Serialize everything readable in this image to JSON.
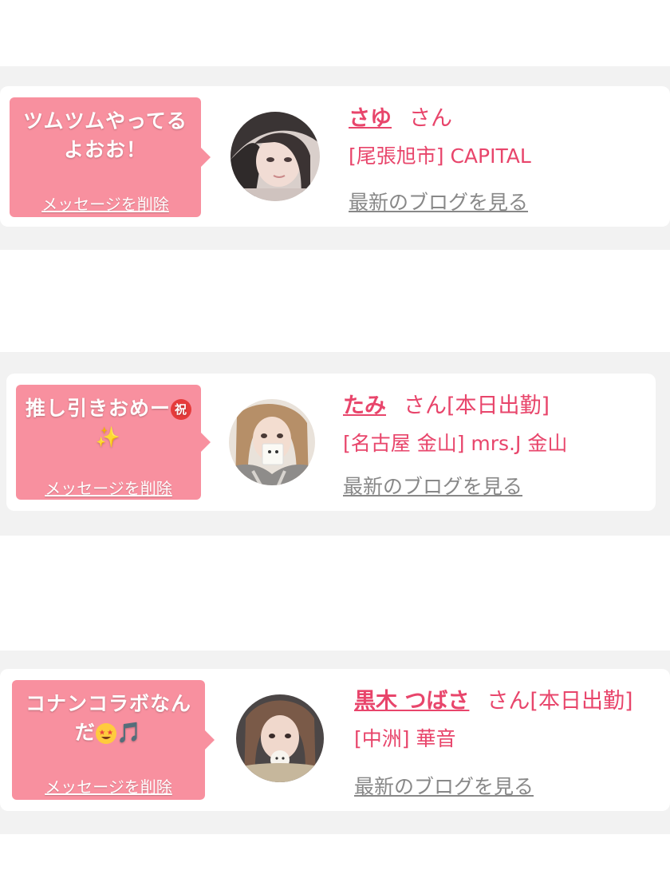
{
  "cards": [
    {
      "message": "ツムツムやってるよおお！",
      "delete_label": "メッセージを削除",
      "name": "さゆ",
      "honorific": "さん",
      "status": "",
      "shop": "[尾張旭市] CAPITAL",
      "blog_label": "最新のブログを見る"
    },
    {
      "message": "推し引きおめー",
      "message_emoji_1": "祝",
      "message_emoji_2": "✨",
      "delete_label": "メッセージを削除",
      "name": "たみ",
      "honorific": "さん",
      "status": "[本日出勤]",
      "shop": "[名古屋 金山] mrs.J 金山",
      "blog_label": "最新のブログを見る"
    },
    {
      "message": "コナンコラボなんだ",
      "message_emoji_2": "🎵",
      "delete_label": "メッセージを削除",
      "name": "黒木 つばさ",
      "honorific": "さん",
      "status": "[本日出勤]",
      "shop": "[中洲] 華音",
      "blog_label": "最新のブログを見る"
    }
  ],
  "colors": {
    "accent": "#e8456b",
    "bubble": "#f8909f",
    "band": "#f2f2f2",
    "link_gray": "#888888"
  },
  "icons": [
    "sparkles-icon",
    "iwai-icon",
    "star-struck-face-icon",
    "music-note-icon"
  ]
}
